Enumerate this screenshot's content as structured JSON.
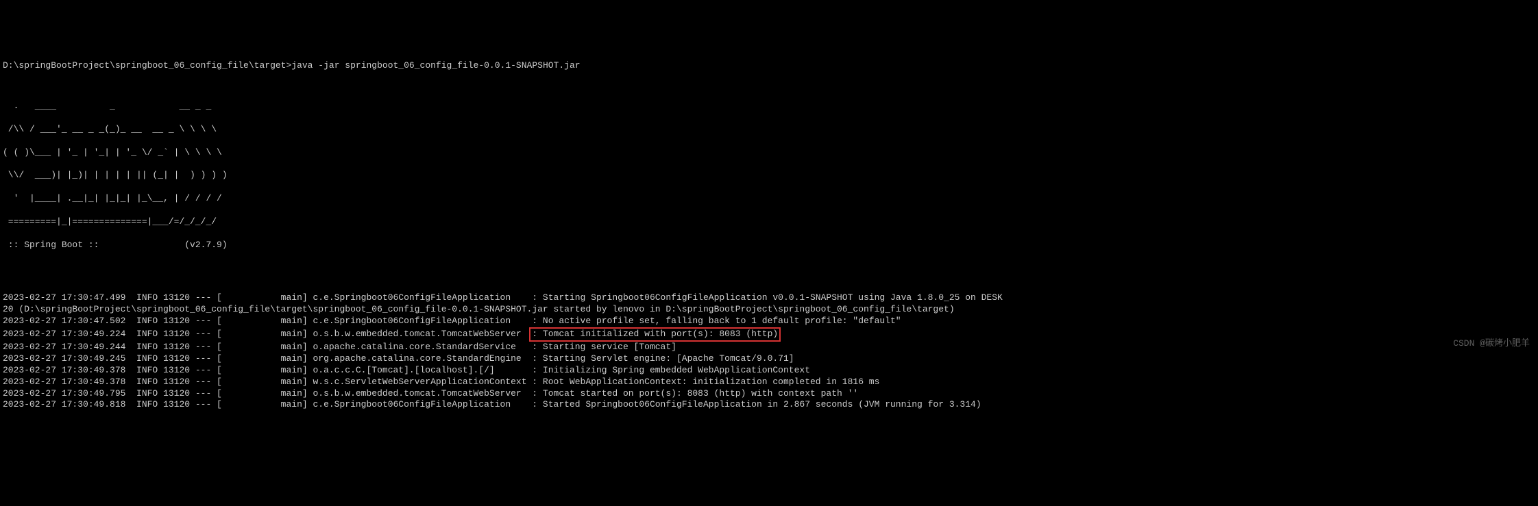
{
  "prompt": {
    "path": "D:\\springBootProject\\springboot_06_config_file\\target>",
    "command": "java -jar springboot_06_config_file-0.0.1-SNAPSHOT.jar"
  },
  "banner": {
    "line1": "  .   ____          _            __ _ _",
    "line2": " /\\\\ / ___'_ __ _ _(_)_ __  __ _ \\ \\ \\ \\",
    "line3": "( ( )\\___ | '_ | '_| | '_ \\/ _` | \\ \\ \\ \\",
    "line4": " \\\\/  ___)| |_)| | | | | || (_| |  ) ) ) )",
    "line5": "  '  |____| .__|_| |_|_| |_\\__, | / / / /",
    "line6": " =========|_|==============|___/=/_/_/_/",
    "line7": " :: Spring Boot ::                (v2.7.9)"
  },
  "logs": [
    {
      "ts": "2023-02-27 17:30:47.499",
      "level": "INFO",
      "pid": "13120",
      "sep": "---",
      "thread": "[           main]",
      "logger": "c.e.Springboot06ConfigFileApplication   ",
      "msg": ": Starting Springboot06ConfigFileApplication v0.0.1-SNAPSHOT using Java 1.8.0_25 on DESK"
    },
    {
      "raw": "20 (D:\\springBootProject\\springboot_06_config_file\\target\\springboot_06_config_file-0.0.1-SNAPSHOT.jar started by lenovo in D:\\springBootProject\\springboot_06_config_file\\target)"
    },
    {
      "ts": "2023-02-27 17:30:47.502",
      "level": "INFO",
      "pid": "13120",
      "sep": "---",
      "thread": "[           main]",
      "logger": "c.e.Springboot06ConfigFileApplication   ",
      "msg": ": No active profile set, falling back to 1 default profile: \"default\""
    },
    {
      "ts": "2023-02-27 17:30:49.224",
      "level": "INFO",
      "pid": "13120",
      "sep": "---",
      "thread": "[           main]",
      "logger": "o.s.b.w.embedded.tomcat.TomcatWebServer ",
      "msg": ": Tomcat initialized with port(s): 8083 (http)",
      "highlighted": true
    },
    {
      "ts": "2023-02-27 17:30:49.244",
      "level": "INFO",
      "pid": "13120",
      "sep": "---",
      "thread": "[           main]",
      "logger": "o.apache.catalina.core.StandardService  ",
      "msg": ": Starting service [Tomcat]"
    },
    {
      "ts": "2023-02-27 17:30:49.245",
      "level": "INFO",
      "pid": "13120",
      "sep": "---",
      "thread": "[           main]",
      "logger": "org.apache.catalina.core.StandardEngine ",
      "msg": ": Starting Servlet engine: [Apache Tomcat/9.0.71]"
    },
    {
      "ts": "2023-02-27 17:30:49.378",
      "level": "INFO",
      "pid": "13120",
      "sep": "---",
      "thread": "[           main]",
      "logger": "o.a.c.c.C.[Tomcat].[localhost].[/]      ",
      "msg": ": Initializing Spring embedded WebApplicationContext"
    },
    {
      "ts": "2023-02-27 17:30:49.378",
      "level": "INFO",
      "pid": "13120",
      "sep": "---",
      "thread": "[           main]",
      "logger": "w.s.c.ServletWebServerApplicationContext",
      "msg": ": Root WebApplicationContext: initialization completed in 1816 ms"
    },
    {
      "ts": "2023-02-27 17:30:49.795",
      "level": "INFO",
      "pid": "13120",
      "sep": "---",
      "thread": "[           main]",
      "logger": "o.s.b.w.embedded.tomcat.TomcatWebServer ",
      "msg": ": Tomcat started on port(s): 8083 (http) with context path ''"
    },
    {
      "ts": "2023-02-27 17:30:49.818",
      "level": "INFO",
      "pid": "13120",
      "sep": "---",
      "thread": "[           main]",
      "logger": "c.e.Springboot06ConfigFileApplication   ",
      "msg": ": Started Springboot06ConfigFileApplication in 2.867 seconds (JVM running for 3.314)"
    }
  ],
  "watermark": "CSDN @碳烤小肥羊"
}
